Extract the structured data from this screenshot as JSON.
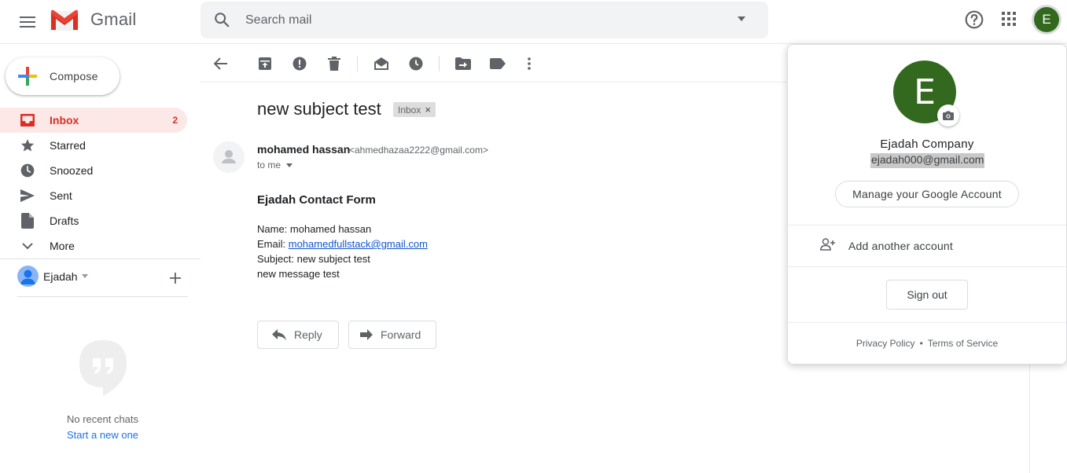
{
  "header": {
    "app_name": "Gmail",
    "search_placeholder": "Search mail",
    "avatar_letter": "E"
  },
  "sidebar": {
    "compose_label": "Compose",
    "items": [
      {
        "label": "Inbox",
        "count": "2",
        "icon": "inbox-icon",
        "active": true
      },
      {
        "label": "Starred",
        "count": "",
        "icon": "star-icon"
      },
      {
        "label": "Snoozed",
        "count": "",
        "icon": "clock-icon"
      },
      {
        "label": "Sent",
        "count": "",
        "icon": "send-icon"
      },
      {
        "label": "Drafts",
        "count": "",
        "icon": "draft-icon"
      },
      {
        "label": "More",
        "count": "",
        "icon": "chevron-down-icon"
      }
    ],
    "hangouts_user": "Ejadah",
    "no_chats": "No recent chats",
    "start_chat": "Start a new one"
  },
  "toolbar": {
    "icons": [
      "back-arrow-icon",
      "archive-icon",
      "report-spam-icon",
      "delete-icon",
      "mark-unread-icon",
      "snooze-icon",
      "move-to-icon",
      "label-icon",
      "more-vert-icon"
    ]
  },
  "message": {
    "subject": "new subject test",
    "label": "Inbox",
    "label_close": "×",
    "sender_name": "mohamed hassan",
    "sender_email": "<ahmedhazaa2222@gmail.com>",
    "to": "to me",
    "body_title": "Ejadah Contact Form",
    "name_line": "Name: mohamed hassan",
    "email_prefix": "Email: ",
    "email_link": "mohamedfullstack@gmail.com",
    "subject_line": "Subject: new subject test",
    "message_line": "new message test",
    "reply_label": "Reply",
    "forward_label": "Forward"
  },
  "account_panel": {
    "avatar_letter": "E",
    "name": "Ejadah Company",
    "email": "ejadah000@gmail.com",
    "manage_label": "Manage your Google Account",
    "add_account_label": "Add another account",
    "sign_out_label": "Sign out",
    "privacy_label": "Privacy Policy",
    "dot": "•",
    "terms_label": "Terms of Service"
  },
  "colors": {
    "accent_red": "#d93025",
    "active_bg": "#fce8e6",
    "avatar_green": "#33691e",
    "link_blue": "#1a73e8"
  }
}
